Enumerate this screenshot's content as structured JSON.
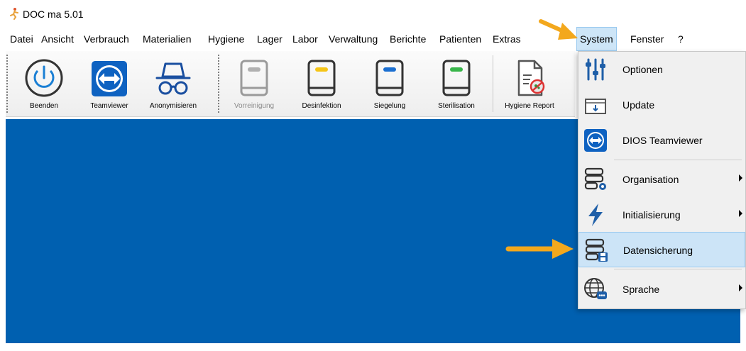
{
  "window": {
    "title": "DOC ma  5.01",
    "logo_icon": "doc-ma-logo-icon"
  },
  "menubar": {
    "items": [
      {
        "label": "Datei"
      },
      {
        "label": "Ansicht"
      },
      {
        "label": "Verbrauch"
      },
      {
        "label": "Materialien"
      },
      {
        "label": "Hygiene"
      },
      {
        "label": "Lager"
      },
      {
        "label": "Labor"
      },
      {
        "label": "Verwaltung"
      },
      {
        "label": "Berichte"
      },
      {
        "label": "Patienten"
      },
      {
        "label": "Extras"
      },
      {
        "label": "System",
        "active": true
      },
      {
        "label": "Fenster"
      },
      {
        "label": "?"
      }
    ]
  },
  "toolbar": {
    "buttons": [
      {
        "label": "Beenden",
        "icon": "power-icon",
        "enabled": true
      },
      {
        "label": "Teamviewer",
        "icon": "teamviewer-icon",
        "enabled": true
      },
      {
        "label": "Anonymisieren",
        "icon": "incognito-icon",
        "enabled": true
      },
      {
        "label": "Vorreinigung",
        "icon": "book-gray-icon",
        "enabled": false
      },
      {
        "label": "Desinfektion",
        "icon": "book-yellow-icon",
        "enabled": true
      },
      {
        "label": "Siegelung",
        "icon": "book-blue-icon",
        "enabled": true
      },
      {
        "label": "Sterilisation",
        "icon": "book-green-icon",
        "enabled": true
      },
      {
        "label": "Hygiene Report",
        "icon": "report-icon",
        "enabled": true
      }
    ]
  },
  "system_menu": {
    "items": [
      {
        "label": "Optionen",
        "icon": "sliders-icon",
        "submenu": false
      },
      {
        "label": "Update",
        "icon": "update-icon",
        "submenu": false
      },
      {
        "label": "DIOS Teamviewer",
        "icon": "teamviewer-icon",
        "submenu": false
      },
      {
        "label": "Organisation",
        "icon": "database-gear-icon",
        "submenu": true
      },
      {
        "label": "Initialisierung",
        "icon": "lightning-icon",
        "submenu": true
      },
      {
        "label": "Datensicherung",
        "icon": "database-save-icon",
        "submenu": false,
        "highlighted": true
      },
      {
        "label": "Sprache",
        "icon": "globe-chat-icon",
        "submenu": true
      }
    ]
  },
  "colors": {
    "workarea": "#0060b0",
    "accent_arrow": "#f3a81d",
    "highlight": "#cce4f7",
    "teamviewer_blue": "#0e62c1"
  }
}
